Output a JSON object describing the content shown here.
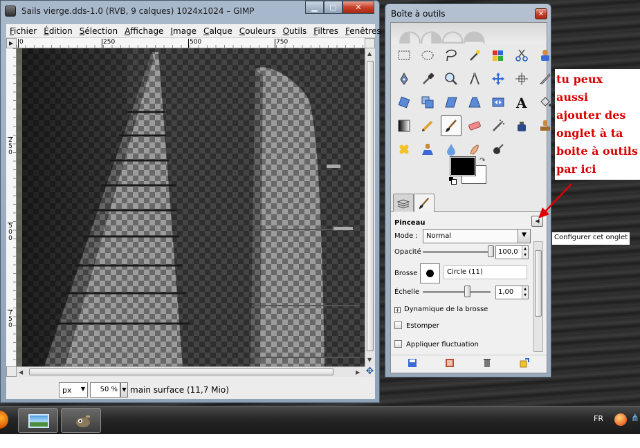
{
  "image_window": {
    "title": "Sails vierge.dds-1.0 (RVB, 9 calques) 1024x1024 – GIMP",
    "menu": [
      {
        "label": "Fichier",
        "key": "F",
        "rest": "ichier"
      },
      {
        "label": "Édition",
        "key": "É",
        "rest": "dition"
      },
      {
        "label": "Sélection",
        "key": "S",
        "rest": "élection"
      },
      {
        "label": "Affichage",
        "key": "A",
        "rest": "ffichage"
      },
      {
        "label": "Image",
        "key": "I",
        "rest": "mage"
      },
      {
        "label": "Calque",
        "key": "C",
        "rest": "alque"
      },
      {
        "label": "Couleurs",
        "key": "C",
        "rest": "ouleurs"
      },
      {
        "label": "Outils",
        "key": "O",
        "rest": "utils"
      },
      {
        "label": "Filtres",
        "key": "F",
        "rest": "iltres"
      },
      {
        "label": "Fenêtres",
        "key": "F",
        "rest": "enêtres"
      }
    ],
    "ruler_h_labels": [
      "0",
      "250",
      "500",
      "750"
    ],
    "ruler_v_labels": [
      "2 5 0",
      "5 0 0",
      "7 5 0"
    ],
    "unit": "px",
    "zoom": "50 %",
    "status": "main surface  (11,7 Mio)"
  },
  "toolbox": {
    "title": "Boîte à outils",
    "tooltip": "Configurer cet onglet",
    "options": {
      "title": "Pinceau",
      "mode_label": "Mode :",
      "mode_value": "Normal",
      "opacity_label": "Opacité",
      "opacity_value": "100,0",
      "brush_label": "Brosse :",
      "brush_value": "Circle (11)",
      "scale_label": "Échelle",
      "scale_value": "1,00",
      "dynamics_label": "Dynamique de la brosse",
      "stamp_label": "Estomper",
      "jitter_label": "Appliquer fluctuation"
    }
  },
  "annotation": "tu peux\naussi\najouter  des\nonglet à ta\nboite à outils\npar ici",
  "taskbar": {
    "lang": "FR"
  },
  "colors": {
    "annotation": "#d80000",
    "foreground": "#000000",
    "background": "#ffffff"
  }
}
